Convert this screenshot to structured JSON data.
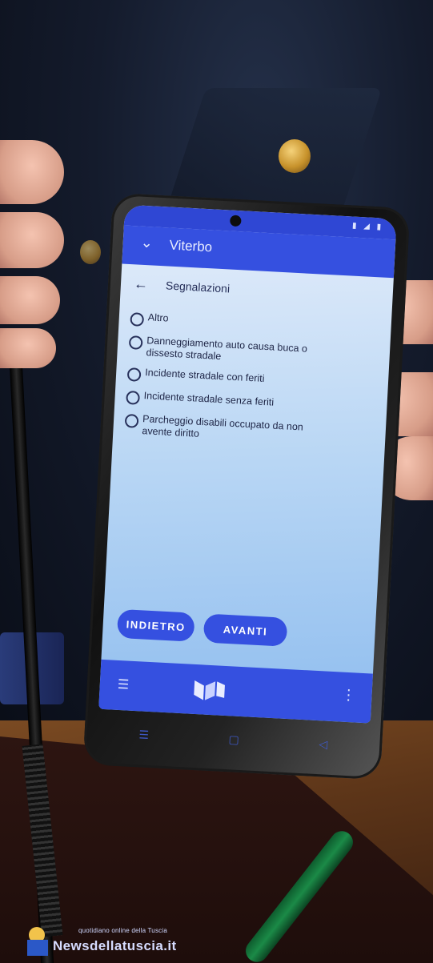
{
  "app": {
    "title": "Viterbo"
  },
  "screen": {
    "header_title": "Segnalazioni",
    "options": [
      "Altro",
      "Danneggiamento auto causa buca o dissesto stradale",
      "Incidente stradale con feriti",
      "Incidente stradale senza feriti",
      "Parcheggio disabili occupato da non avente diritto"
    ],
    "back_button": "INDIETRO",
    "next_button": "AVANTI"
  },
  "icons": {
    "chevron": "chevron-down-icon",
    "back": "arrow-left-icon",
    "menu": "hamburger-icon",
    "logo": "app-logo-icon",
    "more": "more-vertical-icon"
  },
  "colors": {
    "app_bar": "#3550e0",
    "screen_bg": "#b8d6f4"
  },
  "watermark": {
    "line1": "quotidiano online della Tuscia",
    "line2": "Newsdellatuscia.it"
  }
}
